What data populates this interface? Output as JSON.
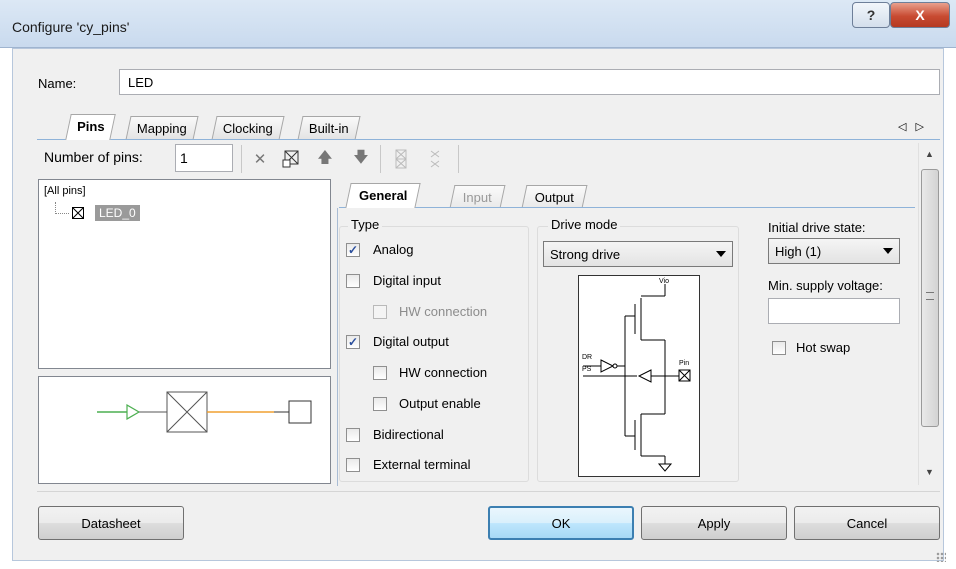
{
  "window": {
    "title": "Configure 'cy_pins'",
    "help_label": "?",
    "close_label": "X"
  },
  "name_field": {
    "label": "Name:",
    "value": "LED"
  },
  "tabs": [
    {
      "label": "Pins"
    },
    {
      "label": "Mapping"
    },
    {
      "label": "Clocking"
    },
    {
      "label": "Built-in"
    }
  ],
  "tab_scroll": "◁ ▷",
  "toolbar": {
    "num_pins_label": "Number of pins:",
    "num_pins_value": "1"
  },
  "pin_tree": {
    "root_label": "[All pins]",
    "items": [
      {
        "label": "LED_0"
      }
    ]
  },
  "sub_tabs": [
    {
      "label": "General"
    },
    {
      "label": "Input"
    },
    {
      "label": "Output"
    }
  ],
  "type_group": {
    "label": "Type",
    "options": [
      {
        "label": "Analog",
        "checked": true
      },
      {
        "label": "Digital input",
        "checked": false
      },
      {
        "label": "HW connection",
        "checked": false,
        "disabled": true
      },
      {
        "label": "Digital output",
        "checked": true
      },
      {
        "label": "HW connection",
        "checked": false
      },
      {
        "label": "Output enable",
        "checked": false
      },
      {
        "label": "Bidirectional",
        "checked": false
      },
      {
        "label": "External terminal",
        "checked": false
      }
    ]
  },
  "drive_mode": {
    "label": "Drive mode",
    "selected": "Strong drive",
    "diagram_labels": {
      "vio": "Vio",
      "dr": "DR",
      "ps": "PS",
      "pin": "Pin"
    }
  },
  "initial_drive_state": {
    "label": "Initial drive state:",
    "selected": "High (1)"
  },
  "min_supply_voltage": {
    "label": "Min. supply voltage:",
    "value": ""
  },
  "hot_swap": {
    "label": "Hot swap",
    "checked": false
  },
  "buttons": {
    "datasheet": "Datasheet",
    "ok": "OK",
    "apply": "Apply",
    "cancel": "Cancel"
  },
  "colors": {
    "accent": "#3c7fb1",
    "wire_green": "#4caf50",
    "wire_orange": "#f0a030"
  }
}
